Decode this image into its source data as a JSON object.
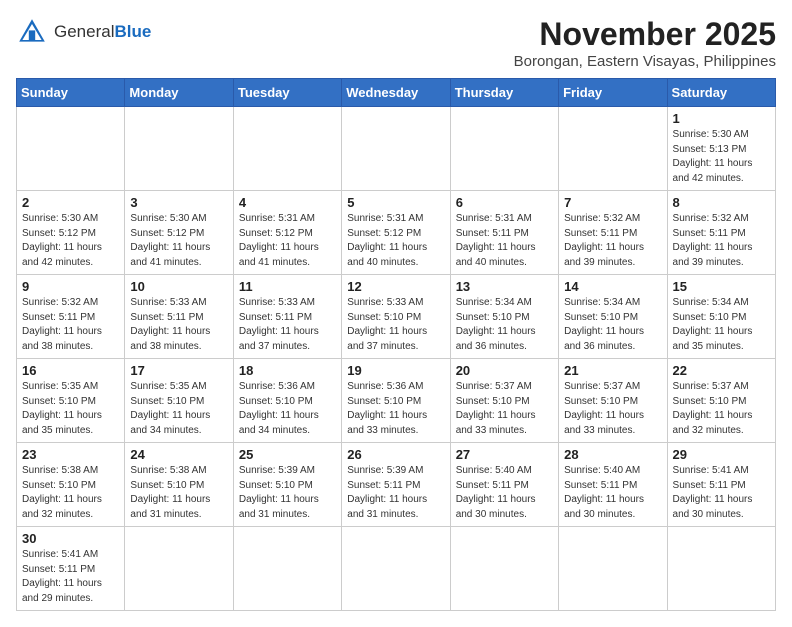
{
  "header": {
    "logo_general": "General",
    "logo_blue": "Blue",
    "month_title": "November 2025",
    "location": "Borongan, Eastern Visayas, Philippines"
  },
  "weekdays": [
    "Sunday",
    "Monday",
    "Tuesday",
    "Wednesday",
    "Thursday",
    "Friday",
    "Saturday"
  ],
  "weeks": [
    [
      {
        "day": null
      },
      {
        "day": null
      },
      {
        "day": null
      },
      {
        "day": null
      },
      {
        "day": null
      },
      {
        "day": null
      },
      {
        "day": 1,
        "sunrise": "Sunrise: 5:30 AM",
        "sunset": "Sunset: 5:13 PM",
        "daylight": "Daylight: 11 hours and 42 minutes."
      }
    ],
    [
      {
        "day": 2,
        "sunrise": "Sunrise: 5:30 AM",
        "sunset": "Sunset: 5:12 PM",
        "daylight": "Daylight: 11 hours and 42 minutes."
      },
      {
        "day": 3,
        "sunrise": "Sunrise: 5:30 AM",
        "sunset": "Sunset: 5:12 PM",
        "daylight": "Daylight: 11 hours and 41 minutes."
      },
      {
        "day": 4,
        "sunrise": "Sunrise: 5:31 AM",
        "sunset": "Sunset: 5:12 PM",
        "daylight": "Daylight: 11 hours and 41 minutes."
      },
      {
        "day": 5,
        "sunrise": "Sunrise: 5:31 AM",
        "sunset": "Sunset: 5:12 PM",
        "daylight": "Daylight: 11 hours and 40 minutes."
      },
      {
        "day": 6,
        "sunrise": "Sunrise: 5:31 AM",
        "sunset": "Sunset: 5:11 PM",
        "daylight": "Daylight: 11 hours and 40 minutes."
      },
      {
        "day": 7,
        "sunrise": "Sunrise: 5:32 AM",
        "sunset": "Sunset: 5:11 PM",
        "daylight": "Daylight: 11 hours and 39 minutes."
      },
      {
        "day": 8,
        "sunrise": "Sunrise: 5:32 AM",
        "sunset": "Sunset: 5:11 PM",
        "daylight": "Daylight: 11 hours and 39 minutes."
      }
    ],
    [
      {
        "day": 9,
        "sunrise": "Sunrise: 5:32 AM",
        "sunset": "Sunset: 5:11 PM",
        "daylight": "Daylight: 11 hours and 38 minutes."
      },
      {
        "day": 10,
        "sunrise": "Sunrise: 5:33 AM",
        "sunset": "Sunset: 5:11 PM",
        "daylight": "Daylight: 11 hours and 38 minutes."
      },
      {
        "day": 11,
        "sunrise": "Sunrise: 5:33 AM",
        "sunset": "Sunset: 5:11 PM",
        "daylight": "Daylight: 11 hours and 37 minutes."
      },
      {
        "day": 12,
        "sunrise": "Sunrise: 5:33 AM",
        "sunset": "Sunset: 5:10 PM",
        "daylight": "Daylight: 11 hours and 37 minutes."
      },
      {
        "day": 13,
        "sunrise": "Sunrise: 5:34 AM",
        "sunset": "Sunset: 5:10 PM",
        "daylight": "Daylight: 11 hours and 36 minutes."
      },
      {
        "day": 14,
        "sunrise": "Sunrise: 5:34 AM",
        "sunset": "Sunset: 5:10 PM",
        "daylight": "Daylight: 11 hours and 36 minutes."
      },
      {
        "day": 15,
        "sunrise": "Sunrise: 5:34 AM",
        "sunset": "Sunset: 5:10 PM",
        "daylight": "Daylight: 11 hours and 35 minutes."
      }
    ],
    [
      {
        "day": 16,
        "sunrise": "Sunrise: 5:35 AM",
        "sunset": "Sunset: 5:10 PM",
        "daylight": "Daylight: 11 hours and 35 minutes."
      },
      {
        "day": 17,
        "sunrise": "Sunrise: 5:35 AM",
        "sunset": "Sunset: 5:10 PM",
        "daylight": "Daylight: 11 hours and 34 minutes."
      },
      {
        "day": 18,
        "sunrise": "Sunrise: 5:36 AM",
        "sunset": "Sunset: 5:10 PM",
        "daylight": "Daylight: 11 hours and 34 minutes."
      },
      {
        "day": 19,
        "sunrise": "Sunrise: 5:36 AM",
        "sunset": "Sunset: 5:10 PM",
        "daylight": "Daylight: 11 hours and 33 minutes."
      },
      {
        "day": 20,
        "sunrise": "Sunrise: 5:37 AM",
        "sunset": "Sunset: 5:10 PM",
        "daylight": "Daylight: 11 hours and 33 minutes."
      },
      {
        "day": 21,
        "sunrise": "Sunrise: 5:37 AM",
        "sunset": "Sunset: 5:10 PM",
        "daylight": "Daylight: 11 hours and 33 minutes."
      },
      {
        "day": 22,
        "sunrise": "Sunrise: 5:37 AM",
        "sunset": "Sunset: 5:10 PM",
        "daylight": "Daylight: 11 hours and 32 minutes."
      }
    ],
    [
      {
        "day": 23,
        "sunrise": "Sunrise: 5:38 AM",
        "sunset": "Sunset: 5:10 PM",
        "daylight": "Daylight: 11 hours and 32 minutes."
      },
      {
        "day": 24,
        "sunrise": "Sunrise: 5:38 AM",
        "sunset": "Sunset: 5:10 PM",
        "daylight": "Daylight: 11 hours and 31 minutes."
      },
      {
        "day": 25,
        "sunrise": "Sunrise: 5:39 AM",
        "sunset": "Sunset: 5:10 PM",
        "daylight": "Daylight: 11 hours and 31 minutes."
      },
      {
        "day": 26,
        "sunrise": "Sunrise: 5:39 AM",
        "sunset": "Sunset: 5:11 PM",
        "daylight": "Daylight: 11 hours and 31 minutes."
      },
      {
        "day": 27,
        "sunrise": "Sunrise: 5:40 AM",
        "sunset": "Sunset: 5:11 PM",
        "daylight": "Daylight: 11 hours and 30 minutes."
      },
      {
        "day": 28,
        "sunrise": "Sunrise: 5:40 AM",
        "sunset": "Sunset: 5:11 PM",
        "daylight": "Daylight: 11 hours and 30 minutes."
      },
      {
        "day": 29,
        "sunrise": "Sunrise: 5:41 AM",
        "sunset": "Sunset: 5:11 PM",
        "daylight": "Daylight: 11 hours and 30 minutes."
      }
    ],
    [
      {
        "day": 30,
        "sunrise": "Sunrise: 5:41 AM",
        "sunset": "Sunset: 5:11 PM",
        "daylight": "Daylight: 11 hours and 29 minutes."
      },
      {
        "day": null
      },
      {
        "day": null
      },
      {
        "day": null
      },
      {
        "day": null
      },
      {
        "day": null
      },
      {
        "day": null
      }
    ]
  ]
}
